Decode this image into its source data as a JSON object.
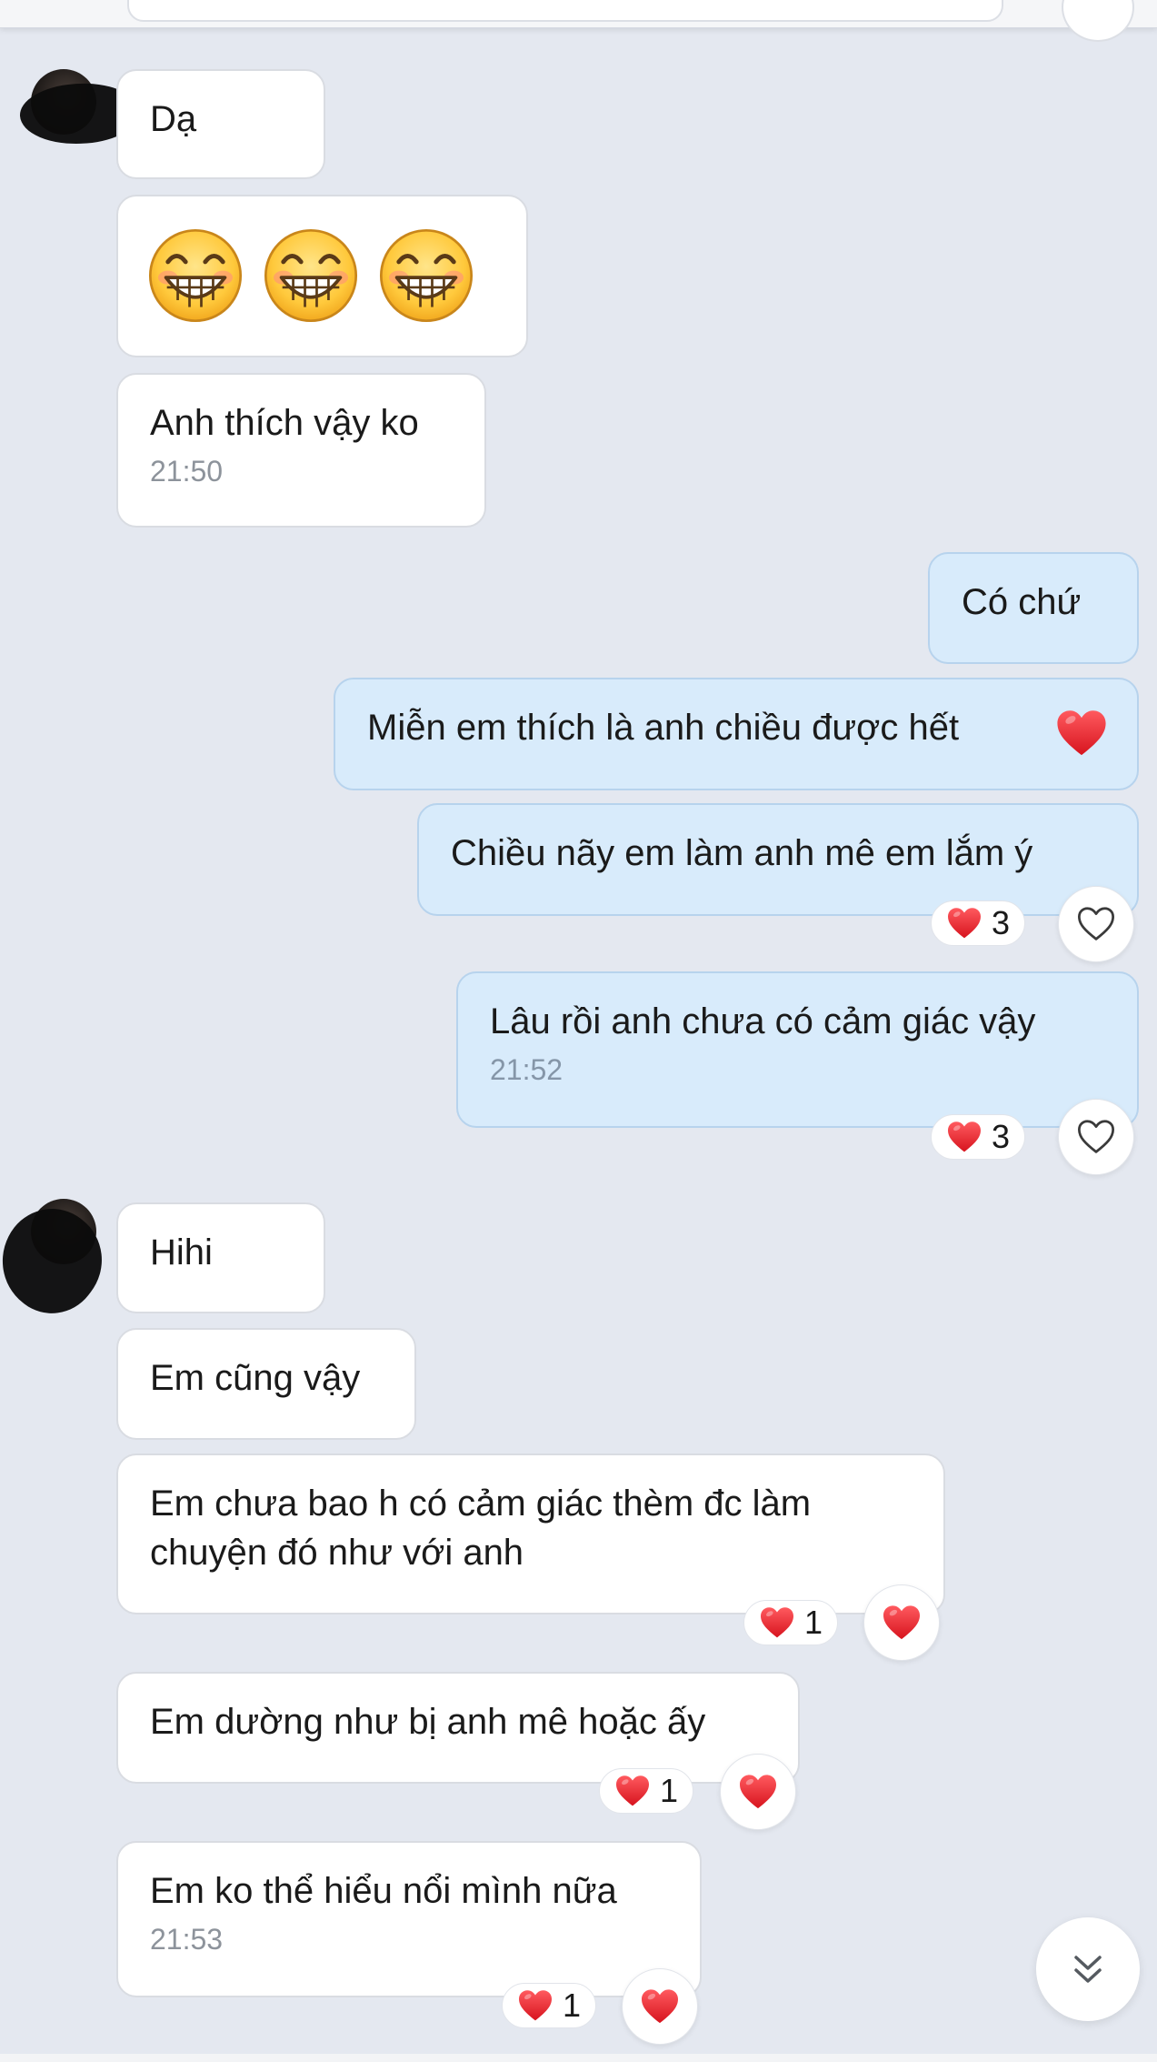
{
  "colors": {
    "background": "#e4e8f0",
    "incoming_bubble": "#ffffff",
    "outgoing_bubble": "#d8ebfb",
    "heart_red": "#e0202b",
    "timestamp": "#8d939b"
  },
  "messages": [
    {
      "side": "incoming",
      "text": "Dạ"
    },
    {
      "side": "incoming",
      "emoji": [
        "grinning-face-icon",
        "grinning-face-icon",
        "grinning-face-icon"
      ]
    },
    {
      "side": "incoming",
      "text": "Anh thích vậy ko",
      "time": "21:50"
    },
    {
      "side": "outgoing",
      "text": "Có chứ"
    },
    {
      "side": "outgoing",
      "text": "Miễn em thích là anh chiều được hết",
      "emoji": "red-heart-icon"
    },
    {
      "side": "outgoing",
      "text": "Chiều nãy em làm anh mê em lắm ý",
      "reaction_count": "3",
      "reaction_icon": "red-heart-icon",
      "react_button": "heart-outline-icon"
    },
    {
      "side": "outgoing",
      "text": "Lâu rồi anh chưa có cảm giác vậy",
      "time": "21:52",
      "reaction_count": "3",
      "reaction_icon": "red-heart-icon",
      "react_button": "heart-outline-icon"
    },
    {
      "side": "incoming",
      "text": "Hihi"
    },
    {
      "side": "incoming",
      "text": "Em cũng vậy"
    },
    {
      "side": "incoming",
      "text_lines": [
        "Em chưa bao h có cảm giác thèm đc làm",
        "chuyện đó như với anh"
      ],
      "reaction_count": "1",
      "reaction_icon": "red-heart-icon",
      "react_button": "red-heart-icon"
    },
    {
      "side": "incoming",
      "text": "Em dường như bị anh mê hoặc ấy",
      "reaction_count": "1",
      "reaction_icon": "red-heart-icon",
      "react_button": "red-heart-icon"
    },
    {
      "side": "incoming",
      "text": "Em ko thể hiểu nổi mình nữa",
      "time": "21:53",
      "reaction_count": "1",
      "reaction_icon": "red-heart-icon",
      "react_button": "red-heart-icon"
    }
  ],
  "scroll_button": {
    "icon": "double-chevron-down-icon"
  }
}
